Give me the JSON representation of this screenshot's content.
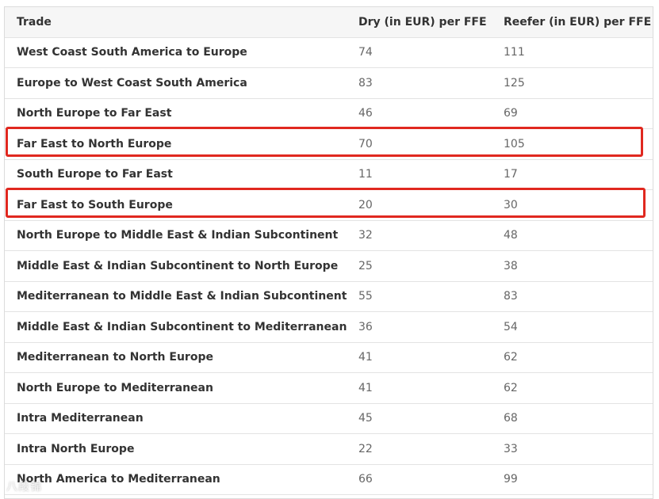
{
  "table": {
    "headers": {
      "trade": "Trade",
      "dry": "Dry (in EUR) per FFE",
      "reefer": "Reefer (in EUR) per FFE"
    },
    "rows": [
      {
        "trade": "West Coast South America to Europe",
        "dry": "74",
        "reefer": "111",
        "highlighted": false
      },
      {
        "trade": "Europe to West Coast South America",
        "dry": "83",
        "reefer": "125",
        "highlighted": false
      },
      {
        "trade": "North Europe to Far East",
        "dry": "46",
        "reefer": "69",
        "highlighted": false
      },
      {
        "trade": "Far East to North Europe",
        "dry": "70",
        "reefer": "105",
        "highlighted": true
      },
      {
        "trade": "South Europe to Far East",
        "dry": "11",
        "reefer": "17",
        "highlighted": false
      },
      {
        "trade": "Far East to South Europe",
        "dry": "20",
        "reefer": "30",
        "highlighted": true
      },
      {
        "trade": "North Europe to Middle East & Indian Subcontinent",
        "dry": "32",
        "reefer": "48",
        "highlighted": false
      },
      {
        "trade": "Middle East & Indian Subcontinent to North Europe",
        "dry": "25",
        "reefer": "38",
        "highlighted": false
      },
      {
        "trade": "Mediterranean to Middle East & Indian Subcontinent",
        "dry": "55",
        "reefer": "83",
        "highlighted": false
      },
      {
        "trade": "Middle East & Indian Subcontinent to Mediterranean",
        "dry": "36",
        "reefer": "54",
        "highlighted": false
      },
      {
        "trade": "Mediterranean to North Europe",
        "dry": "41",
        "reefer": "62",
        "highlighted": false
      },
      {
        "trade": "North Europe to Mediterranean",
        "dry": "41",
        "reefer": "62",
        "highlighted": false
      },
      {
        "trade": "Intra Mediterranean",
        "dry": "45",
        "reefer": "68",
        "highlighted": false
      },
      {
        "trade": "Intra North Europe",
        "dry": "22",
        "reefer": "33",
        "highlighted": false
      },
      {
        "trade": "North America to Mediterranean",
        "dry": "66",
        "reefer": "99",
        "highlighted": false
      }
    ]
  },
  "highlight_color": "#e0281f",
  "watermark": "八段锦"
}
